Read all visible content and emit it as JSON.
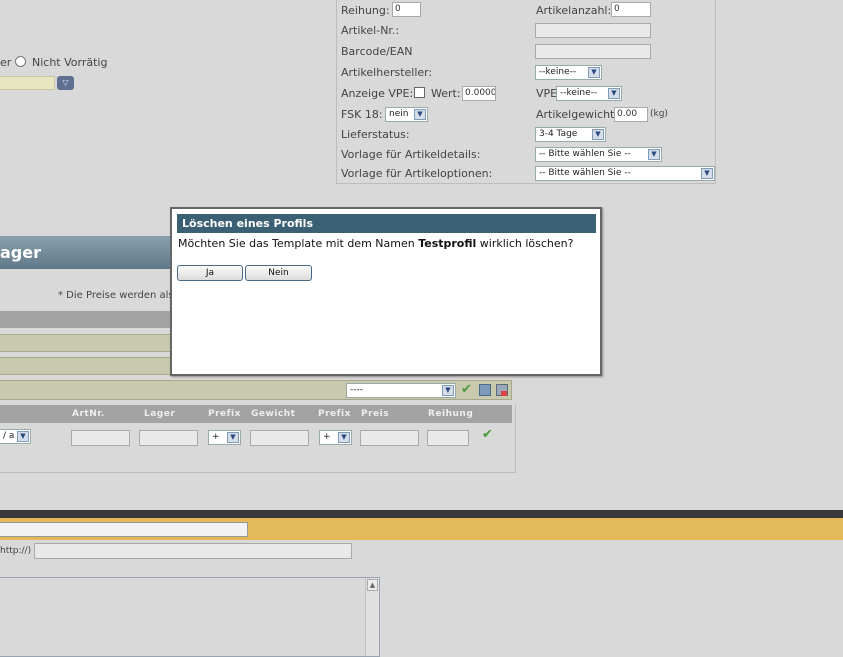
{
  "top_panel": {
    "reihung": {
      "label": "Reihung:",
      "value": "0"
    },
    "artikelanzahl": {
      "label": "Artikelanzahl:",
      "value": "0"
    },
    "artikel_nr": {
      "label": "Artikel-Nr.:",
      "value": ""
    },
    "barcode": {
      "label": "Barcode/EAN",
      "value": ""
    },
    "hersteller": {
      "label": "Artikelhersteller:",
      "value": "--keine--"
    },
    "anzeige_vpe": {
      "label": "Anzeige VPE:",
      "wert_label": "Wert:",
      "wert_value": "0.0000"
    },
    "vpe": {
      "label": "VPE",
      "value": "--keine--"
    },
    "fsk": {
      "label": "FSK 18:",
      "value": "nein"
    },
    "gewicht": {
      "label": "Artikelgewicht:",
      "value": "0.00",
      "unit": "(kg)"
    },
    "lieferstatus": {
      "label": "Lieferstatus:",
      "value": "3-4 Tage"
    },
    "vorlage_details": {
      "label": "Vorlage für Artikeldetails:",
      "value": "-- Bitte wählen Sie --"
    },
    "vorlage_optionen": {
      "label": "Vorlage für Artikeloptionen:",
      "value": "-- Bitte wählen Sie --"
    }
  },
  "left_partial": {
    "radio_prefix": "er",
    "radio_label": "Nicht Vorrätig"
  },
  "section": {
    "title_partial": "ager",
    "price_note": "* Die Preise werden als"
  },
  "option_select": {
    "value": "----"
  },
  "table": {
    "headers": [
      "ArtNr.",
      "Lager",
      "Prefix",
      "Gewicht",
      "Prefix",
      "Preis",
      "Reihung"
    ],
    "row": {
      "first_select": "/ a",
      "prefix1": "+",
      "prefix2": "+"
    }
  },
  "bottom": {
    "url_label": "http://)"
  },
  "dialog": {
    "title": "Löschen eines Profils",
    "message_before": "Möchten Sie das Template mit dem Namen ",
    "profile_name": "Testprofil",
    "message_after": " wirklich löschen?",
    "yes_label": "Ja",
    "no_label": "Nein"
  }
}
